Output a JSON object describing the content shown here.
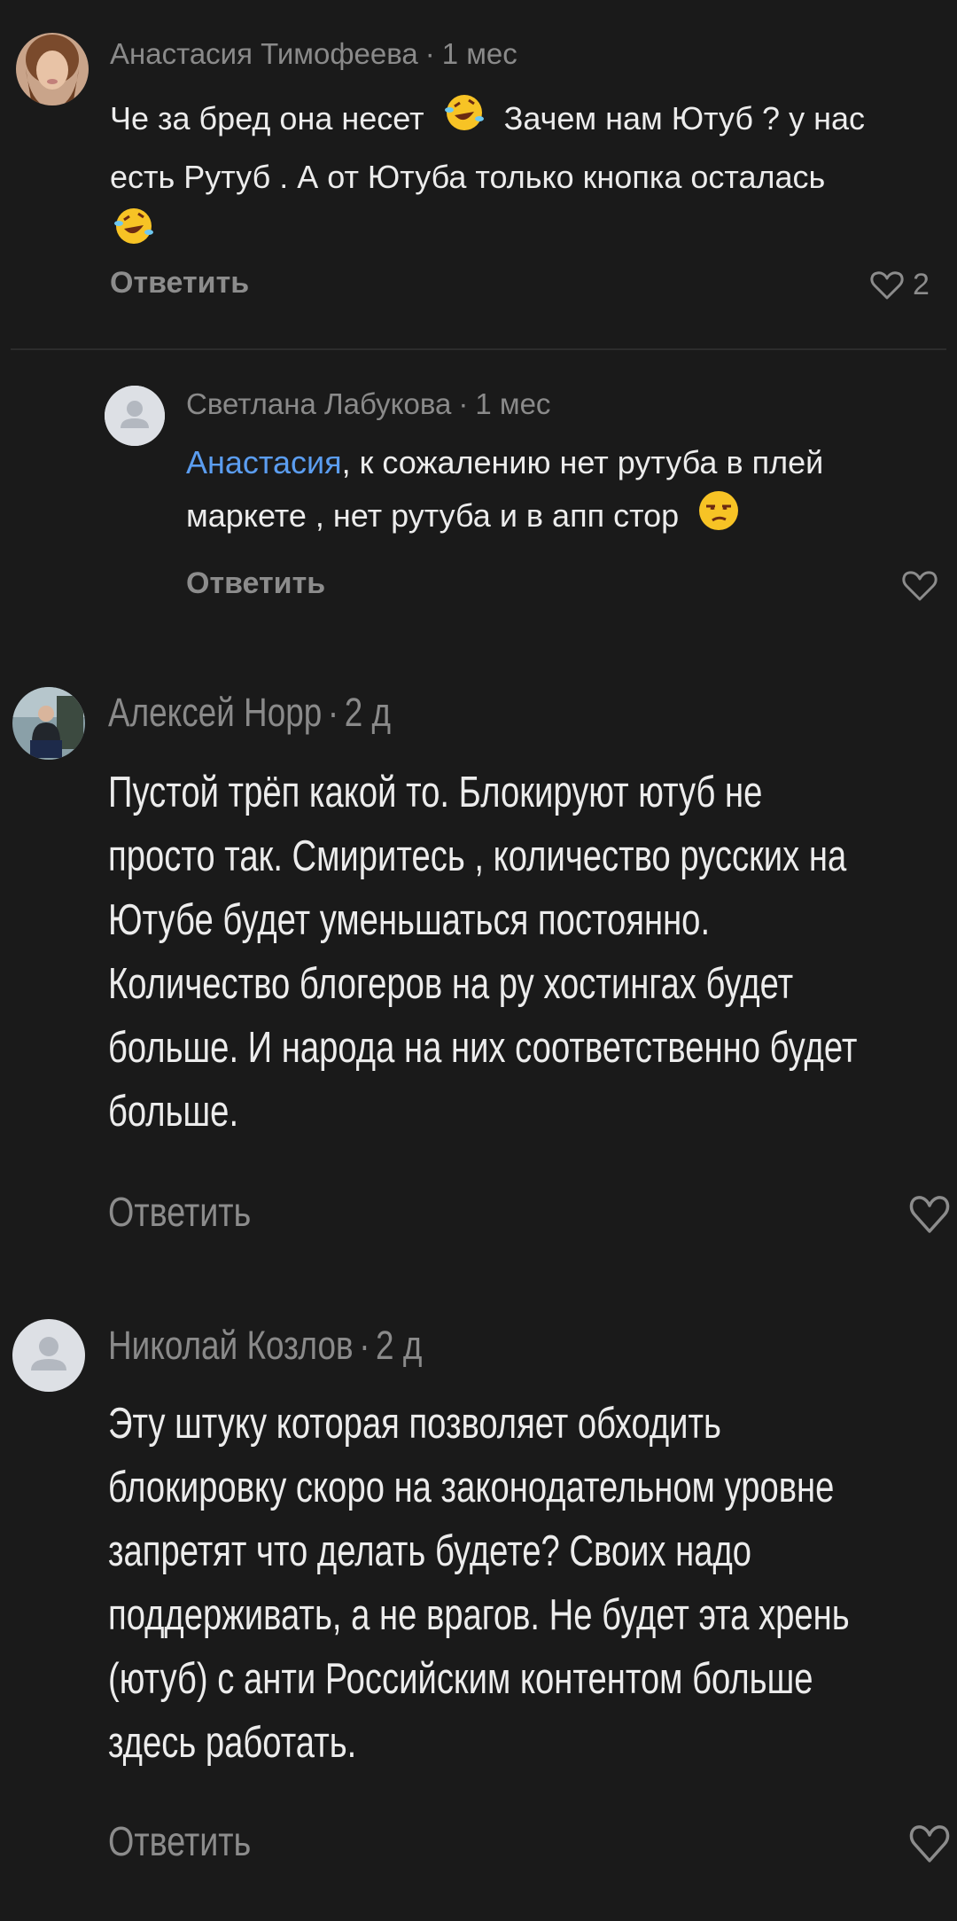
{
  "comments": [
    {
      "author": "Анастасия Тимофеева",
      "time": "1 мес",
      "text_parts": [
        "Че за бред она несет",
        "Зачем нам Ютуб ? у нас",
        "есть Рутуб . А от Ютуба только кнопка осталась"
      ],
      "reply_label": "Ответить",
      "likes": "2",
      "avatar": "photo-avatar"
    },
    {
      "author": "Светлана Лабукова",
      "time": "1 мес",
      "mention": "Анастасия",
      "text_parts": [
        ", к сожалению нет рутуба в плей",
        "маркете , нет рутуба и в апп стор"
      ],
      "reply_label": "Ответить",
      "avatar": "default-avatar"
    },
    {
      "author": "Алексей Норр",
      "time": "2 д",
      "lines": [
        "Пустой трёп какой то. Блокируют ютуб не",
        "просто так. Смиритесь , количество русских на",
        "Ютубе будет уменьшаться постоянно.",
        "Количество блогеров на ру хостингах будет",
        "больше. И народа на них соответственно будет",
        "больше."
      ],
      "reply_label": "Ответить",
      "avatar": "photo-avatar"
    },
    {
      "author": "Николай Козлов",
      "time": "2 д",
      "lines": [
        "Эту штуку которая позволяет обходить",
        "блокировку скоро на законодательном уровне",
        "запретят что делать будете? Своих надо",
        "поддерживать, а не  врагов. Не будет эта хрень",
        "(ютуб) с анти Российским контентом больше",
        "здесь работать."
      ],
      "reply_label": "Ответить",
      "avatar": "default-avatar"
    }
  ],
  "icons": {
    "like": "heart-icon",
    "emoji_laugh": "rolling-on-floor-laughing-emoji",
    "emoji_unamused": "unamused-face-emoji"
  },
  "colors": {
    "background": "#1a1a1a",
    "mention": "#5b9df0",
    "meta": "#8a8a8a"
  }
}
